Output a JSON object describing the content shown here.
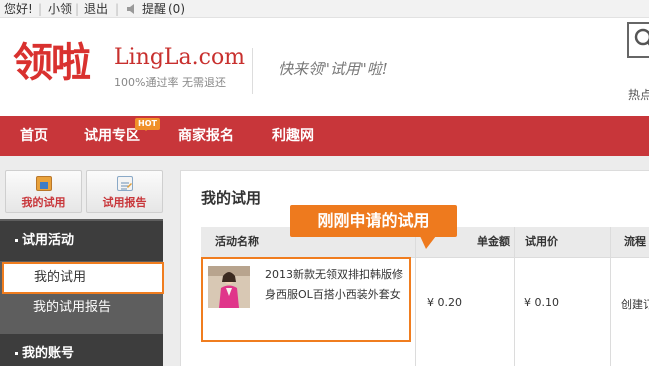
{
  "topbar": {
    "greeting": "您好!",
    "username": "小领",
    "logout": "退出",
    "reminder": "提醒",
    "reminder_count": "(0)"
  },
  "header": {
    "logo_cn": "领啦",
    "logo_en": "LingLa.com",
    "logo_sub": "100%通过率 无需退还",
    "slogan": "快来领\"试用\"啦!",
    "hot_search": "热点"
  },
  "nav": {
    "items": [
      "首页",
      "试用专区",
      "商家报名",
      "利趣网"
    ],
    "hot_badge": "HOT"
  },
  "sidebar": {
    "buttons": [
      {
        "label": "我的试用",
        "icon": "trial-icon"
      },
      {
        "label": "试用报告",
        "icon": "report-icon"
      }
    ],
    "sections": [
      {
        "title": "试用活动",
        "links": [
          "我的试用",
          "我的试用报告"
        ]
      },
      {
        "title": "我的账号",
        "links": []
      }
    ]
  },
  "main": {
    "title": "我的试用",
    "callout": "刚刚申请的试用",
    "columns": [
      "活动名称",
      "单金额",
      "试用价",
      "流程"
    ],
    "rows": [
      {
        "name": "2013新款无领双排扣韩版修身西服OL百搭小西装外套女",
        "amount": "¥ 0.20",
        "trial_price": "¥ 0.10",
        "flow": "创建订"
      }
    ]
  },
  "colors": {
    "brand_red": "#c8363a",
    "highlight_orange": "#ee7a1e",
    "sidebar_dark": "#3d3d3d",
    "sidebar_gray": "#5e5e5e"
  }
}
